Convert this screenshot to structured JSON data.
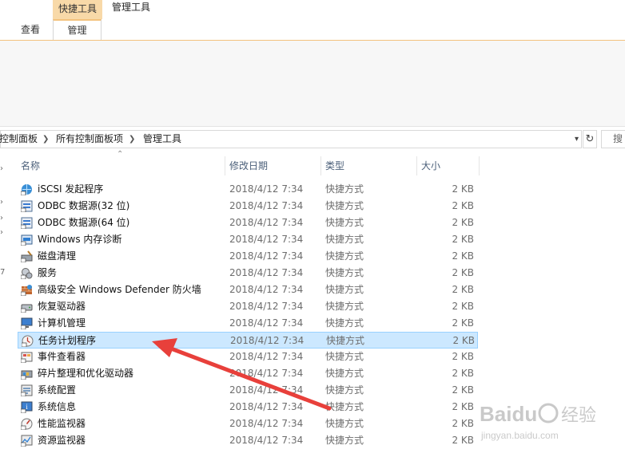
{
  "ribbon": {
    "context_tab": "快捷工具",
    "context_title": "管理工具",
    "tabs": [
      "查看",
      "管理"
    ]
  },
  "address": {
    "crumbs": [
      "控制面板",
      "所有控制面板项",
      "管理工具"
    ],
    "search_placeholder": "搜"
  },
  "columns": {
    "name": "名称",
    "date": "修改日期",
    "type": "类型",
    "size": "大小"
  },
  "nav_marks": [
    "7"
  ],
  "files": [
    {
      "name": "iSCSI 发起程序",
      "date": "2018/4/12 7:34",
      "type": "快捷方式",
      "size": "2 KB",
      "icon": "globe-icon"
    },
    {
      "name": "ODBC 数据源(32 位)",
      "date": "2018/4/12 7:34",
      "type": "快捷方式",
      "size": "2 KB",
      "icon": "database-icon"
    },
    {
      "name": "ODBC 数据源(64 位)",
      "date": "2018/4/12 7:34",
      "type": "快捷方式",
      "size": "2 KB",
      "icon": "database-icon"
    },
    {
      "name": "Windows 内存诊断",
      "date": "2018/4/12 7:34",
      "type": "快捷方式",
      "size": "2 KB",
      "icon": "memory-icon"
    },
    {
      "name": "磁盘清理",
      "date": "2018/4/12 7:34",
      "type": "快捷方式",
      "size": "2 KB",
      "icon": "disk-cleanup-icon"
    },
    {
      "name": "服务",
      "date": "2018/4/12 7:34",
      "type": "快捷方式",
      "size": "2 KB",
      "icon": "gears-icon"
    },
    {
      "name": "高级安全 Windows Defender 防火墙",
      "date": "2018/4/12 7:34",
      "type": "快捷方式",
      "size": "2 KB",
      "icon": "firewall-icon"
    },
    {
      "name": "恢复驱动器",
      "date": "2018/4/12 7:34",
      "type": "快捷方式",
      "size": "2 KB",
      "icon": "drive-icon"
    },
    {
      "name": "计算机管理",
      "date": "2018/4/12 7:34",
      "type": "快捷方式",
      "size": "2 KB",
      "icon": "computer-icon"
    },
    {
      "name": "任务计划程序",
      "date": "2018/4/12 7:34",
      "type": "快捷方式",
      "size": "2 KB",
      "icon": "clock-icon",
      "selected": true
    },
    {
      "name": "事件查看器",
      "date": "2018/4/12 7:34",
      "type": "快捷方式",
      "size": "2 KB",
      "icon": "event-icon"
    },
    {
      "name": "碎片整理和优化驱动器",
      "date": "2018/4/12 7:34",
      "type": "快捷方式",
      "size": "2 KB",
      "icon": "defrag-icon"
    },
    {
      "name": "系统配置",
      "date": "2018/4/12 7:34",
      "type": "快捷方式",
      "size": "2 KB",
      "icon": "config-icon"
    },
    {
      "name": "系统信息",
      "date": "2018/4/12 7:34",
      "type": "快捷方式",
      "size": "2 KB",
      "icon": "info-icon"
    },
    {
      "name": "性能监视器",
      "date": "2018/4/12 7:34",
      "type": "快捷方式",
      "size": "2 KB",
      "icon": "perf-icon"
    },
    {
      "name": "资源监视器",
      "date": "2018/4/12 7:34",
      "type": "快捷方式",
      "size": "2 KB",
      "icon": "resource-icon"
    }
  ],
  "watermark": {
    "brand": "Baidu",
    "cn": "经验",
    "url": "jingyan.baidu.com"
  },
  "colors": {
    "accent": "#f3c27e",
    "selection": "#cce8ff",
    "arrow": "#e8403b"
  }
}
